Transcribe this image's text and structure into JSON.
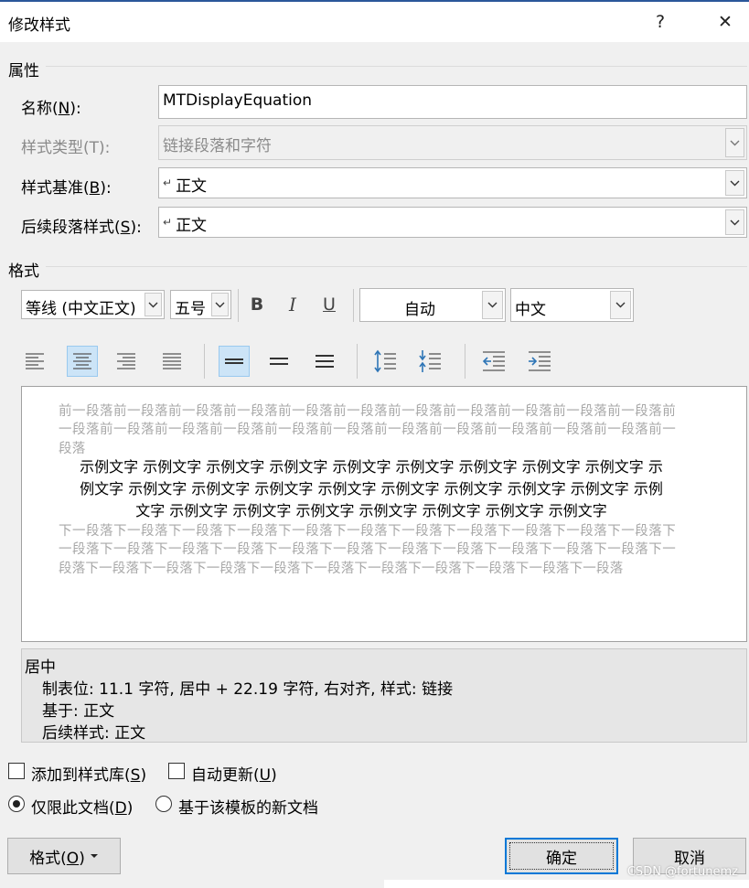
{
  "window": {
    "title": "修改样式",
    "help_icon": "?",
    "close_icon": "✕"
  },
  "properties": {
    "heading": "属性",
    "name_label_pre": "名称(",
    "name_label_key": "N",
    "name_label_post": "):",
    "name_value": "MTDisplayEquation",
    "style_type_label": "样式类型(T):",
    "style_type_value": "链接段落和字符",
    "based_on_label_pre": "样式基准(",
    "based_on_label_key": "B",
    "based_on_label_post": "):",
    "based_on_value": "正文",
    "next_label_pre": "后续段落样式(",
    "next_label_key": "S",
    "next_label_post": "):",
    "next_value": "正文"
  },
  "format": {
    "heading": "格式",
    "font": "等线 (中文正文)",
    "size": "五号",
    "bold": "B",
    "italic": "I",
    "underline": "U",
    "color": "自动",
    "script": "中文"
  },
  "preview": {
    "prev_para": "前一段落前一段落前一段落前一段落前一段落前一段落前一段落前一段落前一段落前一段落前一段落前一段落前一段落前一段落前一段落前一段落前一段落前一段落前一段落前一段落前一段落前一段落前一段落",
    "sample_line1": "示例文字 示例文字 示例文字 示例文字 示例文字 示例文字 示例文字 示例文字 示例文字 示",
    "sample_line2": "例文字 示例文字 示例文字 示例文字 示例文字 示例文字 示例文字 示例文字 示例文字 示例",
    "sample_line3": "文字 示例文字 示例文字 示例文字 示例文字 示例文字 示例文字 示例文字",
    "next_para": "下一段落下一段落下一段落下一段落下一段落下一段落下一段落下一段落下一段落下一段落下一段落下一段落下一段落下一段落下一段落下一段落下一段落下一段落下一段落下一段落下一段落下一段落下一段落下一段落下一段落下一段落下一段落下一段落下一段落下一段落下一段落下一段落下一段落"
  },
  "description": {
    "line1": "居中",
    "line2": "制表位:  11.1 字符, 居中 +  22.19 字符, 右对齐, 样式: 链接",
    "line3": "基于: 正文",
    "line4": "后续样式: 正文"
  },
  "options": {
    "add_gallery_pre": "添加到样式库(",
    "add_gallery_key": "S",
    "add_gallery_post": ")",
    "auto_update_pre": "自动更新(",
    "auto_update_key": "U",
    "auto_update_post": ")",
    "this_doc_pre": "仅限此文档(",
    "this_doc_key": "D",
    "this_doc_post": ")",
    "new_docs": "基于该模板的新文档",
    "add_gallery_checked": false,
    "auto_update_checked": false,
    "selected_scope": "this_doc"
  },
  "buttons": {
    "format_pre": "格式(",
    "format_key": "O",
    "format_post": ")",
    "ok": "确定",
    "cancel": "取消"
  },
  "watermark": "CSDN @fortunemz",
  "colors": {
    "accent": "#0078d7",
    "pressed": "#cce4f7",
    "title_line": "#2b579a",
    "arrow_blue": "#2e75b6"
  }
}
